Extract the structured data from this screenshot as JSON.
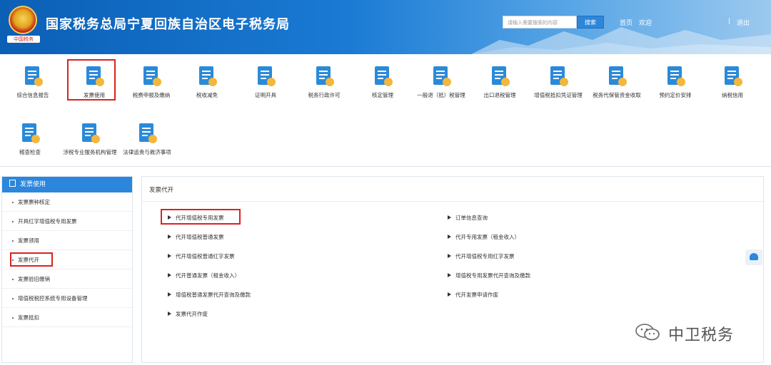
{
  "header": {
    "site_title": "国家税务总局宁夏回族自治区电子税务局",
    "emblem_text": "中国税务",
    "search_placeholder": "请输入需要搜索的内容",
    "search_button": "搜索",
    "home_link": "首页",
    "welcome": "欢迎",
    "logout": "退出"
  },
  "menu": [
    {
      "label": "综合信息报告",
      "icon": "document-report-icon"
    },
    {
      "label": "发票使用",
      "icon": "invoice-icon",
      "highlighted": true
    },
    {
      "label": "税费申报及缴纳",
      "icon": "tax-payment-icon"
    },
    {
      "label": "税收减免",
      "icon": "tax-reduction-icon"
    },
    {
      "label": "证明开具",
      "icon": "certificate-icon"
    },
    {
      "label": "税务行政许可",
      "icon": "admin-permit-icon"
    },
    {
      "label": "核定管理",
      "icon": "assessment-icon"
    },
    {
      "label": "一般退（抵）税管理",
      "icon": "refund-icon"
    },
    {
      "label": "出口退税管理",
      "icon": "export-refund-icon"
    },
    {
      "label": "增值税抵扣凭证管理",
      "icon": "vat-deduction-icon"
    },
    {
      "label": "税务代保管资金收取",
      "icon": "custody-fund-icon"
    },
    {
      "label": "预约定价安排",
      "icon": "pricing-arrangement-icon"
    },
    {
      "label": "纳税信用",
      "icon": "credit-icon"
    },
    {
      "label": "稽查检查",
      "icon": "inspection-icon"
    },
    {
      "label": "涉税专业服务机构管理",
      "icon": "agency-management-icon"
    },
    {
      "label": "法律追责与救济事项",
      "icon": "legal-remedy-icon"
    }
  ],
  "sidebar": {
    "title": "发票使用",
    "items": [
      {
        "label": "发票票种核定"
      },
      {
        "label": "开具红字增值税专用发票"
      },
      {
        "label": "发票领用"
      },
      {
        "label": "发票代开",
        "highlighted": true
      },
      {
        "label": "发票验旧缴销"
      },
      {
        "label": "增值税税控系统专用设备管理"
      },
      {
        "label": "发票抵扣"
      }
    ]
  },
  "main": {
    "title": "发票代开",
    "left_links": [
      {
        "label": "代开增值税专用发票",
        "highlighted": true
      },
      {
        "label": "代开增值税普通发票"
      },
      {
        "label": "代开增值税普通红字发票"
      },
      {
        "label": "代开普通发票（租金收入）"
      },
      {
        "label": "增值税普通发票代开查询及缴款"
      },
      {
        "label": "发票代开作废"
      }
    ],
    "right_links": [
      {
        "label": "订单信息查询"
      },
      {
        "label": "代开专用发票（租金收入）"
      },
      {
        "label": "代开增值税专用红字发票"
      },
      {
        "label": "增值税专用发票代开查询及缴款"
      },
      {
        "label": "代开发票申请作废"
      }
    ]
  },
  "watermark": "中卫税务",
  "colors": {
    "brand_blue": "#2b86dc",
    "highlight_red": "#d9231d"
  }
}
